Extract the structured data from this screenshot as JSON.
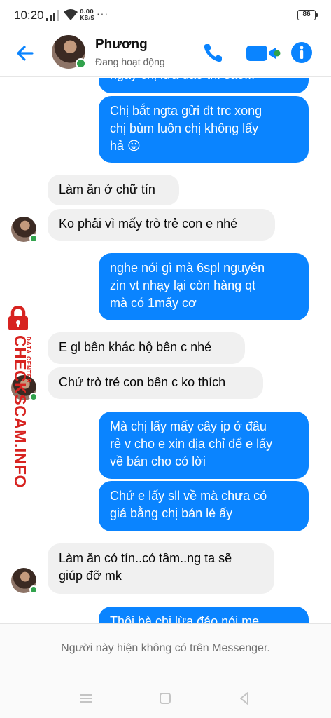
{
  "status_bar": {
    "time": "10:20",
    "net_speed_value": "0.00",
    "net_speed_unit": "KB/S",
    "battery": "86"
  },
  "header": {
    "contact_name": "Phương",
    "contact_status": "Đang hoạt động",
    "accent_color": "#0a84ff",
    "online_color": "#31a24c"
  },
  "messages": [
    {
      "direction": "out",
      "text": "ngày chị lừa đảo thì sao..."
    },
    {
      "direction": "out",
      "text": "Chị bắt ngta gửi đt trc xong\nchị bùm luôn chị không lấy\nhả 😛"
    },
    {
      "direction": "in",
      "text": "Làm ăn ở chữ tín"
    },
    {
      "direction": "in",
      "text": "Ko phải vì mấy trò trẻ con e nhé"
    },
    {
      "direction": "out",
      "text": "nghe nói gì mà 6spl nguyên\nzin vt nhạy lại còn hàng qt\nmà có 1mấy cơ"
    },
    {
      "direction": "in",
      "text": "E gl bên khác hộ bên c nhé"
    },
    {
      "direction": "in",
      "text": "Chứ trò trẻ con bên c ko thích"
    },
    {
      "direction": "out",
      "text": "Mà chị lấy mấy cây ip ở đâu\nrẻ v cho e xin địa chỉ để e lấy\nvề bán cho có lời"
    },
    {
      "direction": "out",
      "text": "Chứ e lấy sll về mà chưa có\ngiá bằng chị bán lẻ ấy"
    },
    {
      "direction": "in",
      "text": "Làm ăn có tín..có tâm..ng ta sẽ\ngiúp đỡ mk"
    },
    {
      "direction": "out",
      "text": "Thôi bà chị lừa đảo nói me..."
    }
  ],
  "watermark": {
    "brand": "CHECKSCAM.INFO",
    "tagline": "DATA CENTER",
    "color": "#d72320"
  },
  "footer": {
    "notice": "Người này hiện không có trên Messenger."
  },
  "icons": {
    "back": "arrow-left-icon",
    "call": "phone-icon",
    "video": "video-camera-icon",
    "info": "info-icon",
    "nav_menu": "menu-icon",
    "nav_home": "square-icon",
    "nav_back": "triangle-back-icon"
  }
}
